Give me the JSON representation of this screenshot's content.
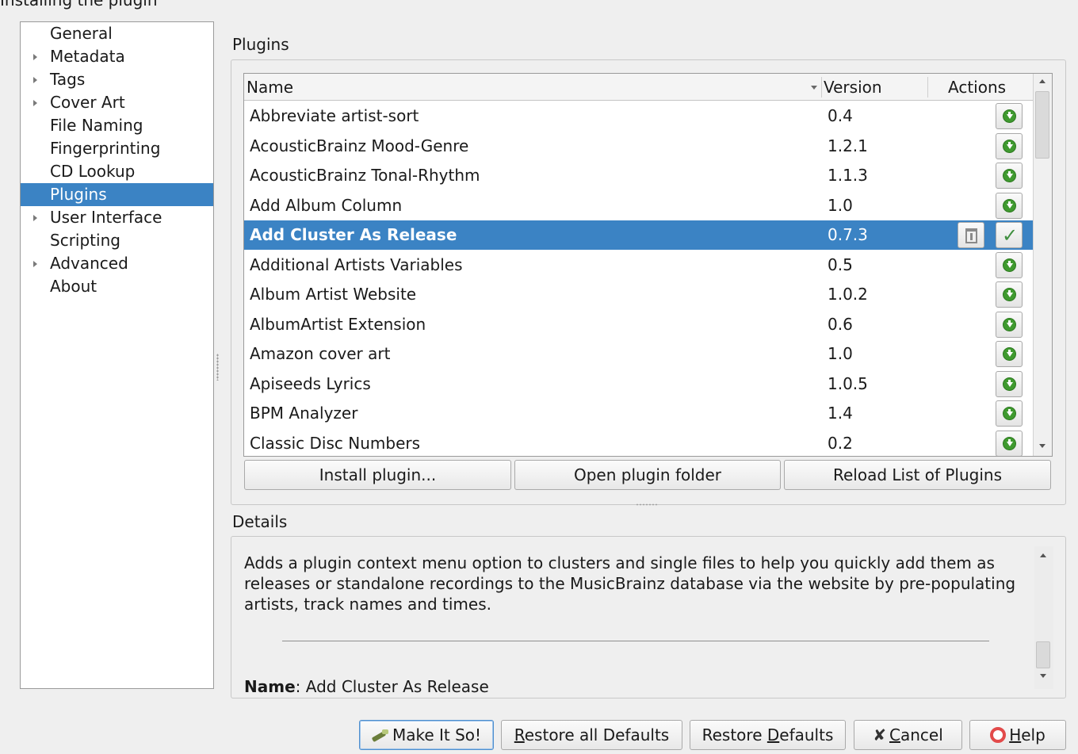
{
  "caption": "Installing the plugin",
  "sidebar": {
    "items": [
      {
        "label": "General",
        "expandable": false,
        "selected": false
      },
      {
        "label": "Metadata",
        "expandable": true,
        "selected": false
      },
      {
        "label": "Tags",
        "expandable": true,
        "selected": false
      },
      {
        "label": "Cover Art",
        "expandable": true,
        "selected": false
      },
      {
        "label": "File Naming",
        "expandable": false,
        "selected": false
      },
      {
        "label": "Fingerprinting",
        "expandable": false,
        "selected": false
      },
      {
        "label": "CD Lookup",
        "expandable": false,
        "selected": false
      },
      {
        "label": "Plugins",
        "expandable": false,
        "selected": true
      },
      {
        "label": "User Interface",
        "expandable": true,
        "selected": false
      },
      {
        "label": "Scripting",
        "expandable": false,
        "selected": false
      },
      {
        "label": "Advanced",
        "expandable": true,
        "selected": false
      },
      {
        "label": "About",
        "expandable": false,
        "selected": false
      }
    ]
  },
  "plugins": {
    "title": "Plugins",
    "columns": {
      "name": "Name",
      "version": "Version",
      "actions": "Actions"
    },
    "rows": [
      {
        "name": "Abbreviate artist-sort",
        "version": "0.4",
        "installed": false
      },
      {
        "name": "AcousticBrainz Mood-Genre",
        "version": "1.2.1",
        "installed": false
      },
      {
        "name": "AcousticBrainz Tonal-Rhythm",
        "version": "1.1.3",
        "installed": false
      },
      {
        "name": "Add Album Column",
        "version": "1.0",
        "installed": false
      },
      {
        "name": "Add Cluster As Release",
        "version": "0.7.3",
        "installed": true,
        "selected": true
      },
      {
        "name": "Additional Artists Variables",
        "version": "0.5",
        "installed": false
      },
      {
        "name": "Album Artist Website",
        "version": "1.0.2",
        "installed": false
      },
      {
        "name": "AlbumArtist Extension",
        "version": "0.6",
        "installed": false
      },
      {
        "name": "Amazon cover art",
        "version": "1.0",
        "installed": false
      },
      {
        "name": "Apiseeds Lyrics",
        "version": "1.0.5",
        "installed": false
      },
      {
        "name": "BPM Analyzer",
        "version": "1.4",
        "installed": false
      },
      {
        "name": "Classic Disc Numbers",
        "version": "0.2",
        "installed": false
      }
    ],
    "buttons": {
      "install": "Install plugin...",
      "open_folder": "Open plugin folder",
      "reload": "Reload List of Plugins"
    }
  },
  "details": {
    "title": "Details",
    "description": "Adds a plugin context menu option to clusters and single files to help you quickly add them as releases or standalone recordings to the MusicBrainz database via the website by pre-populating artists, track names and times.",
    "name_label": "Name",
    "name_value": ": Add Cluster As Release"
  },
  "footer": {
    "make_it_so": "Make It So!",
    "restore_all": {
      "pre": "",
      "mn": "R",
      "post": "estore all Defaults"
    },
    "restore": {
      "pre": "Restore ",
      "mn": "D",
      "post": "efaults"
    },
    "cancel": {
      "pre": "",
      "mn": "C",
      "post": "ancel"
    },
    "help": {
      "pre": "",
      "mn": "H",
      "post": "elp"
    }
  },
  "colors": {
    "selection": "#3b83c4",
    "install_icon": "#3f9a2f",
    "window_bg": "#efefef"
  }
}
